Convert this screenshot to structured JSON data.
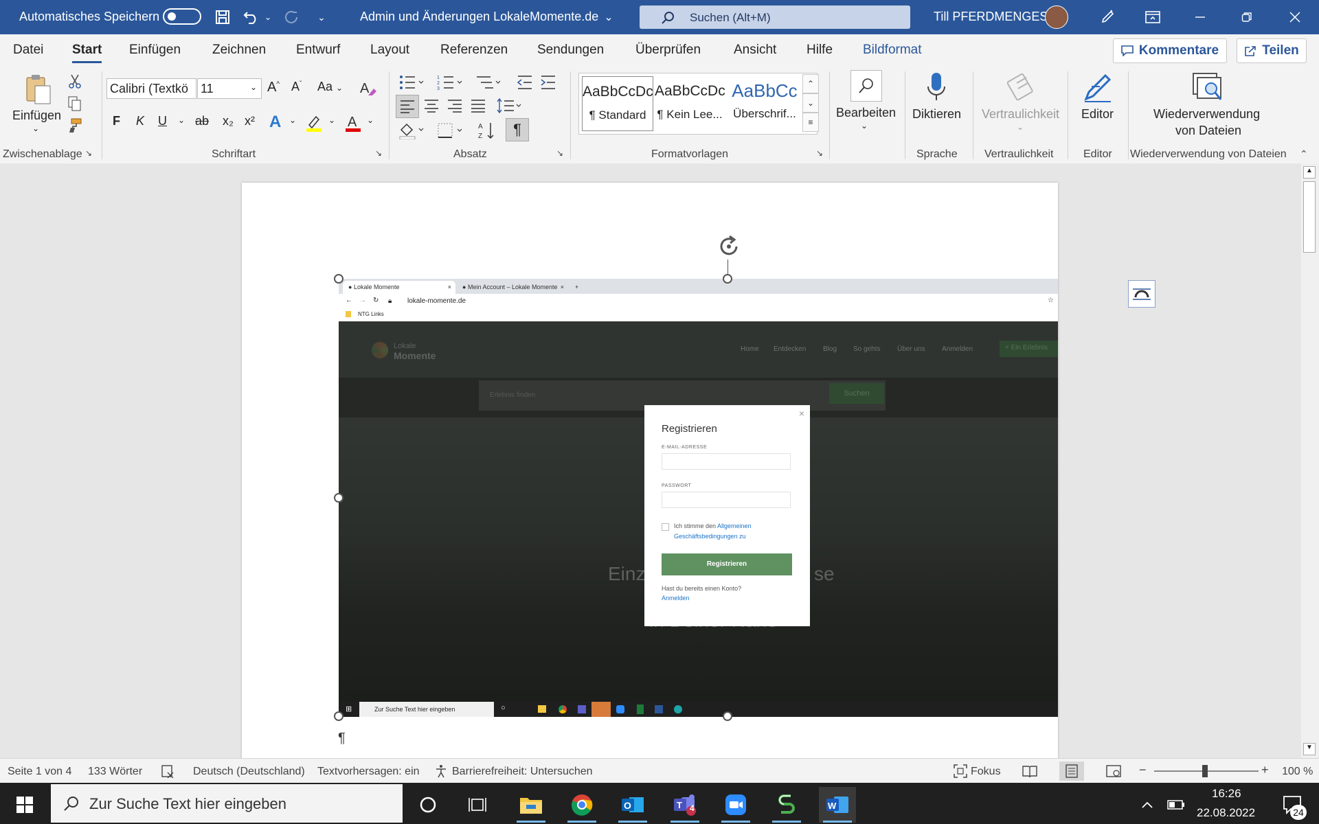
{
  "titlebar": {
    "autosave_label": "Automatisches Speichern",
    "doc_title": "Admin und Änderungen LokaleMomente.de",
    "search_placeholder": "Suchen (Alt+M)",
    "user_name": "Till PFERDMENGES"
  },
  "menu": {
    "tabs": [
      "Datei",
      "Start",
      "Einfügen",
      "Zeichnen",
      "Entwurf",
      "Layout",
      "Referenzen",
      "Sendungen",
      "Überprüfen",
      "Ansicht",
      "Hilfe",
      "Bildformat"
    ],
    "active_tab": "Start",
    "comments_label": "Kommentare",
    "share_label": "Teilen"
  },
  "ribbon": {
    "clipboard": {
      "paste_label": "Einfügen",
      "group_label": "Zwischenablage"
    },
    "font": {
      "font_name": "Calibri (Textkö",
      "font_size": "11",
      "group_label": "Schriftart",
      "bold": "F",
      "italic": "K",
      "underline": "U",
      "strike": "ab",
      "subscript": "x₂",
      "superscript": "x²",
      "change_case": "Aa",
      "grow": "A",
      "shrink": "A",
      "effects": "A",
      "color": "A"
    },
    "paragraph": {
      "group_label": "Absatz",
      "pilcrow": "¶"
    },
    "styles": {
      "group_label": "Formatvorlagen",
      "items": [
        {
          "preview": "AaBbCcDc",
          "name": "¶ Standard"
        },
        {
          "preview": "AaBbCcDc",
          "name": "¶ Kein Lee..."
        },
        {
          "preview": "AaBbCc",
          "name": "Überschrif..."
        }
      ]
    },
    "editing": {
      "label": "Bearbeiten"
    },
    "voice": {
      "label": "Diktieren",
      "group_label": "Sprache"
    },
    "sensitivity": {
      "label": "Vertraulichkeit",
      "group_label": "Vertraulichkeit"
    },
    "editor": {
      "label": "Editor",
      "group_label": "Editor"
    },
    "reuse": {
      "label_line1": "Wiederverwendung",
      "label_line2": "von Dateien",
      "group_label": "Wiederverwendung von Dateien"
    }
  },
  "embedded": {
    "tab1": "Lokale Momente",
    "tab2": "Mein Account – Lokale Momente",
    "url": "lokale-momente.de",
    "bookmark": "NTG Links",
    "logo_line1": "Lokale",
    "logo_line2": "Momente",
    "nav": [
      "Home",
      "Entdecken",
      "Blog",
      "So gehts",
      "Über uns",
      "Anmelden"
    ],
    "nav_cta": "+ Ein Erlebnis",
    "search_placeholder": "Erlebnis finden",
    "search_button": "Suchen",
    "hero_line1": "Einz",
    "hero_line1_end": "se",
    "hero_line2": "in Deiner Nähe",
    "modal": {
      "title": "Registrieren",
      "email_label": "E-MAIL-ADRESSE",
      "password_label": "PASSWORT",
      "terms_prefix": "Ich stimme den ",
      "terms_link1": "Allgemeinen",
      "terms_link2": "Geschäftsbedingungen zu",
      "submit": "Registrieren",
      "have_account": "Hast du bereits einen Konto?",
      "login": "Anmelden",
      "close": "×"
    },
    "taskbar_search": "Zur Suche Text hier eingeben"
  },
  "document": {
    "pilcrow": "¶"
  },
  "status": {
    "page": "Seite 1 von 4",
    "words": "133 Wörter",
    "language": "Deutsch (Deutschland)",
    "predictions": "Textvorhersagen: ein",
    "accessibility": "Barrierefreiheit: Untersuchen",
    "focus": "Fokus",
    "zoom": "100 %"
  },
  "taskbar": {
    "search_placeholder": "Zur Suche Text hier eingeben",
    "time": "16:26",
    "date": "22.08.2022",
    "notifications": "24",
    "teams_badge": "4"
  },
  "colors": {
    "word_blue": "#2b579a",
    "green_button": "#5f9161",
    "link_blue": "#1a73c9"
  }
}
